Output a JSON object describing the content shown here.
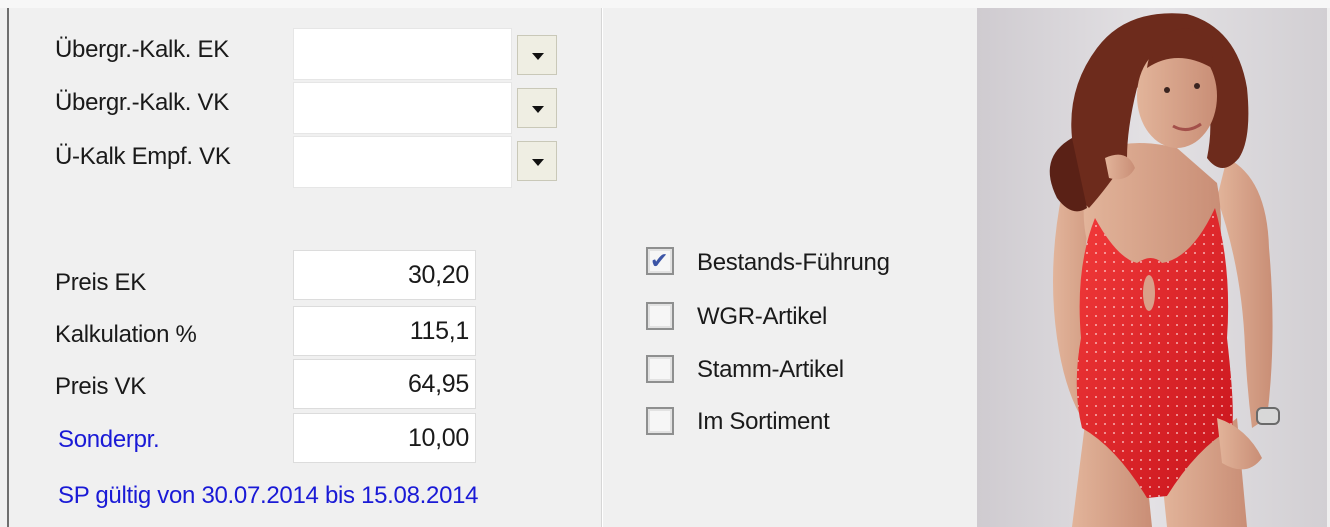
{
  "calc": {
    "uebergr_ek_label": "Übergr.-Kalk. EK",
    "uebergr_vk_label": "Übergr.-Kalk. VK",
    "ue_kalk_empf_vk_label": "Ü-Kalk Empf. VK",
    "uebergr_ek_value": "",
    "uebergr_vk_value": "",
    "ue_kalk_empf_vk_value": ""
  },
  "prices": {
    "preis_ek_label": "Preis EK",
    "preis_ek_value": "30,20",
    "kalkulation_label": "Kalkulation %",
    "kalkulation_value": "115,1",
    "preis_vk_label": "Preis VK",
    "preis_vk_value": "64,95",
    "sonderpreis_label": "Sonderpr.",
    "sonderpreis_value": "10,00",
    "sp_validity": "SP gültig von 30.07.2014 bis 15.08.2014"
  },
  "flags": {
    "items": [
      {
        "label": "Bestands-Führung",
        "checked": true
      },
      {
        "label": "WGR-Artikel",
        "checked": false
      },
      {
        "label": "Stamm-Artikel",
        "checked": false
      },
      {
        "label": "Im Sortiment",
        "checked": false
      }
    ]
  },
  "colors": {
    "window_bg": "#f0f0f0",
    "link_blue": "#1a1ad6",
    "swimsuit_red": "#e4242a",
    "photo_bg": "#d8d5d8"
  },
  "icons": {
    "dropdown": "chevron-down-icon",
    "checkmark": "check-icon"
  }
}
